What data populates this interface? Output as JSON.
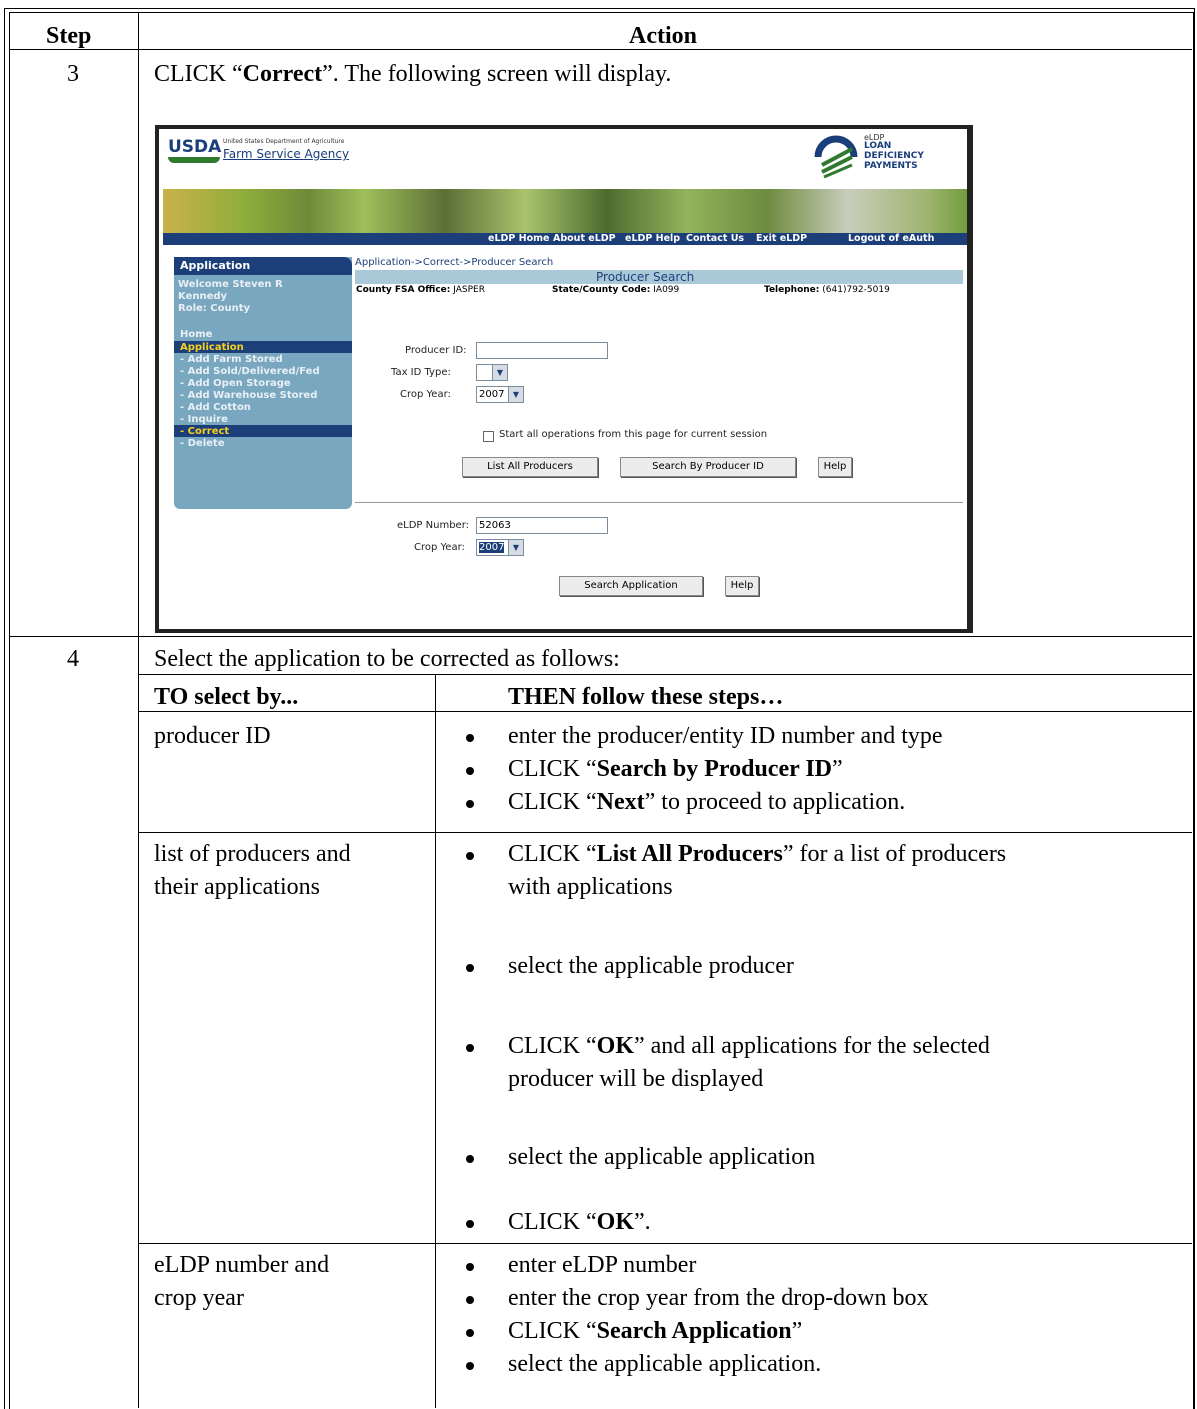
{
  "headers": {
    "step": "Step",
    "action": "Action"
  },
  "step3": {
    "num": "3",
    "pre": "CLICK “",
    "bold": "Correct",
    "post": "”.  The following screen will display."
  },
  "screenshot": {
    "usda": "USDA",
    "usda_sub": "United States Department of Agriculture",
    "agency": "Farm Service Agency",
    "eldp_logo": [
      "eLDP",
      "LOAN",
      "DEFICIENCY",
      "PAYMENTS"
    ],
    "nav": [
      "eLDP Home",
      "About eLDP",
      "eLDP Help",
      "Contact Us",
      "Exit eLDP",
      "Logout of eAuth"
    ],
    "sidebar": {
      "header": "Application",
      "welcome": [
        "Welcome  Steven R",
        "Kennedy",
        "Role: County"
      ],
      "home": "Home",
      "section": "Application",
      "items": [
        "- Add Farm Stored",
        "- Add Sold/Delivered/Fed",
        "- Add Open Storage",
        "- Add Warehouse Stored",
        "- Add Cotton",
        "- Inquire",
        "- Correct",
        "- Delete"
      ]
    },
    "breadcrumb": "Application->Correct->Producer Search",
    "page_title": "Producer Search",
    "county_label": "County FSA Office:",
    "county_value": "JASPER",
    "state_label": "State/County Code:",
    "state_value": "IA099",
    "phone_label": "Telephone:",
    "phone_value": "(641)792-5019",
    "producer_id_label": "Producer ID:",
    "producer_id_value": "",
    "tax_id_label": "Tax ID Type:",
    "tax_id_value": "",
    "crop_year_label": "Crop Year:",
    "crop_year_value": "2007",
    "checkbox_label": "Start all operations from this page for current session",
    "btn_list": "List All Producers",
    "btn_search": "Search By Producer ID",
    "btn_help": "Help",
    "eldp_label": "eLDP Number:",
    "eldp_value": "52063",
    "crop_year2_label": "Crop Year:",
    "crop_year2_value": "2007",
    "btn_search_app": "Search Application",
    "btn_help2": "Help"
  },
  "step4": {
    "num": "4",
    "intro": "Select the application to be corrected as follows:",
    "col1": "TO select by...",
    "col2": "THEN follow these steps…",
    "rows": [
      {
        "by": [
          "producer ID"
        ],
        "steps": [
          {
            "pre": "enter the producer/entity ID number and type",
            "bold": "",
            "post": ""
          },
          {
            "pre": "CLICK “",
            "bold": "Search by Producer ID",
            "post": "”"
          },
          {
            "pre": "CLICK “",
            "bold": "Next",
            "post": "” to proceed to application."
          }
        ]
      },
      {
        "by": [
          "list of producers and",
          "their applications"
        ],
        "steps": [
          {
            "pre": "CLICK “",
            "bold": "List All Producers",
            "post": "” for a list of producers",
            "line2": "with applications"
          },
          {
            "pre": "select the applicable producer",
            "bold": "",
            "post": ""
          },
          {
            "pre": "CLICK “",
            "bold": "OK",
            "post": "” and all applications for the selected",
            "line2": "producer will be displayed"
          },
          {
            "pre": "select the applicable application",
            "bold": "",
            "post": ""
          },
          {
            "pre": "CLICK “",
            "bold": "OK",
            "post": "”."
          }
        ]
      },
      {
        "by": [
          "eLDP number and",
          "crop year"
        ],
        "steps": [
          {
            "pre": "enter eLDP number",
            "bold": "",
            "post": ""
          },
          {
            "pre": "enter the crop year from the drop-down box",
            "bold": "",
            "post": ""
          },
          {
            "pre": "CLICK “",
            "bold": "Search Application",
            "post": "”"
          },
          {
            "pre": "select the applicable application.",
            "bold": "",
            "post": ""
          }
        ]
      }
    ]
  }
}
